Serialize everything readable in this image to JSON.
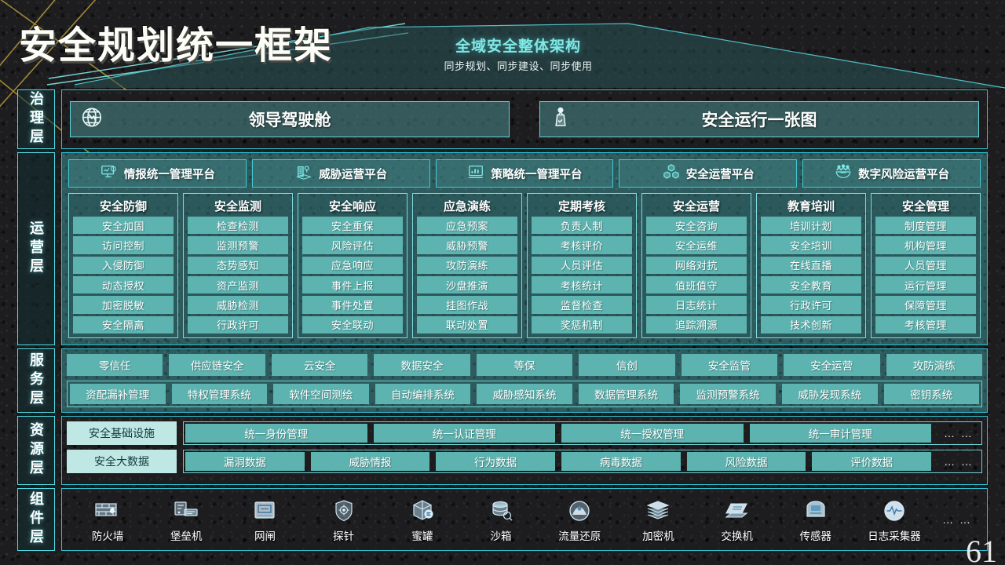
{
  "header": {
    "title": "安全规划统一框架",
    "subtitle_main": "全域安全整体架构",
    "subtitle_sub": "同步规划、同步建设、同步使用"
  },
  "page_number": "61",
  "colors": {
    "accent_cyan": "#4fd8e0",
    "chip_teal": "#5db3b0",
    "panel_teal": "#2d5b5e",
    "bg_dark": "#1d1d1f",
    "gold": "#b99a3a",
    "head_chip": "#bfe7e4"
  },
  "governance": {
    "label": "治理层",
    "cards": [
      {
        "icon": "globe-icon",
        "label": "领导驾驶舱"
      },
      {
        "icon": "podium-icon",
        "label": "安全运行一张图"
      }
    ]
  },
  "operations": {
    "label": "运营层",
    "platforms": [
      {
        "icon": "monitor-chart-icon",
        "label": "情报统一管理平台"
      },
      {
        "icon": "building-pin-icon",
        "label": "威胁运营平台"
      },
      {
        "icon": "bar-chart-screen-icon",
        "label": "策略统一管理平台"
      },
      {
        "icon": "cubes-icon",
        "label": "安全运营平台"
      },
      {
        "icon": "globe-people-icon",
        "label": "数字风险运营平台"
      }
    ],
    "columns": [
      {
        "title": "安全防御",
        "items": [
          "安全加固",
          "访问控制",
          "入侵防御",
          "动态授权",
          "加密脱敏",
          "安全隔离"
        ]
      },
      {
        "title": "安全监测",
        "items": [
          "检查检测",
          "监测预警",
          "态势感知",
          "资产监测",
          "威胁检测",
          "行政许可"
        ]
      },
      {
        "title": "安全响应",
        "items": [
          "安全重保",
          "风险评估",
          "应急响应",
          "事件上报",
          "事件处置",
          "安全联动"
        ]
      },
      {
        "title": "应急演练",
        "items": [
          "应急预案",
          "威胁预警",
          "攻防演练",
          "沙盘推演",
          "挂图作战",
          "联动处置"
        ]
      },
      {
        "title": "定期考核",
        "items": [
          "负责人制",
          "考核评价",
          "人员评估",
          "考核统计",
          "监督检查",
          "奖惩机制"
        ]
      },
      {
        "title": "安全运营",
        "items": [
          "安全咨询",
          "安全运维",
          "网络对抗",
          "值班值守",
          "日志统计",
          "追踪溯源"
        ]
      },
      {
        "title": "教育培训",
        "items": [
          "培训计划",
          "安全培训",
          "在线直播",
          "安全教育",
          "行政许可",
          "技术创新"
        ]
      },
      {
        "title": "安全管理",
        "items": [
          "制度管理",
          "机构管理",
          "人员管理",
          "运行管理",
          "保障管理",
          "考核管理"
        ]
      }
    ]
  },
  "service": {
    "label": "服务层",
    "row1": [
      "零信任",
      "供应链安全",
      "云安全",
      "数据安全",
      "等保",
      "信创",
      "安全监管",
      "安全运营",
      "攻防演练"
    ],
    "row2": [
      "资配漏补管理",
      "特权管理系统",
      "软件空间测绘",
      "自动编排系统",
      "威胁感知系统",
      "数据管理系统",
      "监测预警系统",
      "威胁发现系统",
      "密钥系统"
    ]
  },
  "resource": {
    "label": "资源层",
    "rows": [
      {
        "head": "安全基础设施",
        "chips": [
          "统一身份管理",
          "统一认证管理",
          "统一授权管理",
          "统一审计管理"
        ],
        "ellipsis": "… …"
      },
      {
        "head": "安全大数据",
        "chips": [
          "漏洞数据",
          "威胁情报",
          "行为数据",
          "病毒数据",
          "风险数据",
          "评价数据"
        ],
        "ellipsis": "… …"
      }
    ]
  },
  "component": {
    "label": "组件层",
    "ellipsis": "… …",
    "items": [
      {
        "icon": "firewall-icon",
        "label": "防火墙"
      },
      {
        "icon": "bastion-host-icon",
        "label": "堡垒机"
      },
      {
        "icon": "network-gate-icon",
        "label": "网闸"
      },
      {
        "icon": "probe-icon",
        "label": "探针"
      },
      {
        "icon": "honeypot-icon",
        "label": "蜜罐"
      },
      {
        "icon": "sandbox-icon",
        "label": "沙箱"
      },
      {
        "icon": "traffic-restore-icon",
        "label": "流量还原"
      },
      {
        "icon": "encryptor-icon",
        "label": "加密机"
      },
      {
        "icon": "switch-icon",
        "label": "交换机"
      },
      {
        "icon": "sensor-icon",
        "label": "传感器"
      },
      {
        "icon": "log-collector-icon",
        "label": "日志采集器"
      }
    ]
  }
}
